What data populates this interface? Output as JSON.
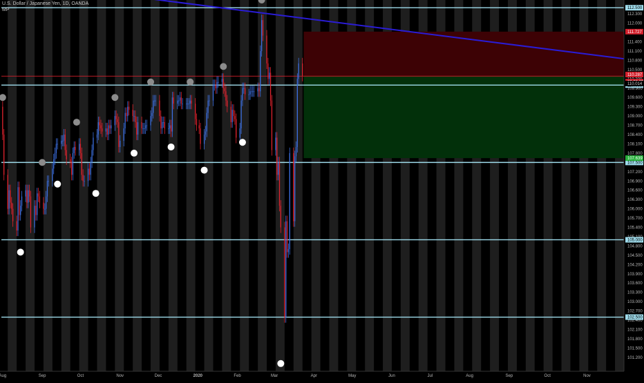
{
  "header": {
    "symbol_line": "U.S. Dollar / Japanese Yen, 1D, OANDA",
    "indicator": "MP"
  },
  "colors": {
    "background": "#000000",
    "band": "#1e1e1e",
    "up": "#3c6fe0",
    "down": "#e0232e",
    "level_line": "#9fdcec",
    "trend_line": "#2a1cd6",
    "loss_zone": "#3d0205",
    "profit_zone": "#02300a",
    "label_bg": "#9fdcec",
    "price_tag": "#d21f2b",
    "tp_tag": "#26b03a",
    "marker_grey": "#8c8c8c",
    "marker_white": "#ffffff"
  },
  "chart_data": {
    "type": "candlestick",
    "title": "U.S. Dollar / Japanese Yen, 1D, OANDA",
    "ylim": [
      100.75,
      112.75
    ],
    "y_ticks": [
      101.2,
      101.5,
      101.8,
      102.1,
      102.4,
      102.7,
      103.0,
      103.3,
      103.6,
      103.9,
      104.2,
      104.5,
      104.8,
      105.1,
      105.4,
      105.7,
      106.0,
      106.3,
      106.6,
      106.9,
      107.2,
      107.5,
      107.8,
      108.1,
      108.4,
      108.7,
      109.0,
      109.3,
      109.6,
      109.9,
      110.2,
      110.5,
      110.8,
      111.1,
      111.4,
      111.7,
      112.0,
      112.3
    ],
    "y_tick_labels": [
      "101.200",
      "101.500",
      "101.800",
      "102.100",
      "102.400",
      "102.700",
      "103.000",
      "103.300",
      "103.600",
      "103.900",
      "104.200",
      "104.500",
      "104.800",
      "105.100",
      "105.400",
      "105.700",
      "106.000",
      "106.300",
      "106.600",
      "106.900",
      "107.200",
      "107.500",
      "107.800",
      "108.100",
      "108.400",
      "108.700",
      "109.000",
      "109.300",
      "109.600",
      "109.900",
      "110.200",
      "110.500",
      "110.800",
      "111.100",
      "111.400",
      "111.700",
      "112.000",
      "112.300"
    ],
    "x_ticks": [
      {
        "label": "Aug",
        "date": "2019-08-01"
      },
      {
        "label": "Sep",
        "date": "2019-09-01"
      },
      {
        "label": "Oct",
        "date": "2019-10-01"
      },
      {
        "label": "Nov",
        "date": "2019-11-01"
      },
      {
        "label": "Dec",
        "date": "2019-12-01"
      },
      {
        "label": "2020",
        "date": "2020-01-01"
      },
      {
        "label": "Feb",
        "date": "2020-02-01"
      },
      {
        "label": "Mar",
        "date": "2020-03-01"
      },
      {
        "label": "Apr",
        "date": "2020-04-01"
      },
      {
        "label": "May",
        "date": "2020-05-01"
      },
      {
        "label": "Jun",
        "date": "2020-06-01"
      },
      {
        "label": "Jul",
        "date": "2020-07-01"
      },
      {
        "label": "Aug",
        "date": "2020-08-01"
      },
      {
        "label": "Sep",
        "date": "2020-09-01"
      },
      {
        "label": "Oct",
        "date": "2020-10-01"
      },
      {
        "label": "Nov",
        "date": "2020-11-01"
      }
    ],
    "x_range": [
      "2019-07-31",
      "2020-11-30"
    ],
    "weekly_shading": "alternating weeks",
    "series": [
      {
        "values": [
          [
            "2019-08-01",
            109.3,
            108.4
          ],
          [
            "2019-08-02",
            108.4,
            107.1
          ],
          [
            "2019-08-05",
            107.1,
            106.0
          ],
          [
            "2019-08-06",
            106.0,
            106.6
          ],
          [
            "2019-08-07",
            106.6,
            106.2
          ],
          [
            "2019-08-08",
            106.2,
            106.0
          ],
          [
            "2019-08-09",
            106.0,
            105.6
          ],
          [
            "2019-08-12",
            105.6,
            105.3
          ],
          [
            "2019-08-13",
            105.3,
            106.7
          ],
          [
            "2019-08-14",
            106.7,
            105.8
          ],
          [
            "2019-08-15",
            105.8,
            106.1
          ],
          [
            "2019-08-16",
            106.1,
            106.4
          ],
          [
            "2019-08-19",
            106.4,
            106.6
          ],
          [
            "2019-08-20",
            106.6,
            106.2
          ],
          [
            "2019-08-21",
            106.2,
            106.6
          ],
          [
            "2019-08-22",
            106.6,
            106.4
          ],
          [
            "2019-08-23",
            106.4,
            105.4
          ],
          [
            "2019-08-26",
            105.4,
            106.1
          ],
          [
            "2019-08-27",
            106.1,
            105.8
          ],
          [
            "2019-08-28",
            105.8,
            106.5
          ],
          [
            "2019-08-29",
            106.5,
            106.4
          ],
          [
            "2019-08-30",
            106.4,
            106.2
          ],
          [
            "2019-09-02",
            106.2,
            106.0
          ],
          [
            "2019-09-03",
            106.0,
            106.0
          ],
          [
            "2019-09-04",
            106.0,
            106.4
          ],
          [
            "2019-09-05",
            106.4,
            106.9
          ],
          [
            "2019-09-06",
            106.9,
            106.9
          ],
          [
            "2019-09-09",
            106.9,
            107.3
          ],
          [
            "2019-09-10",
            107.3,
            107.6
          ],
          [
            "2019-09-11",
            107.6,
            107.8
          ],
          [
            "2019-09-12",
            107.8,
            108.1
          ],
          [
            "2019-09-13",
            108.1,
            108.1
          ],
          [
            "2019-09-16",
            108.1,
            108.2
          ],
          [
            "2019-09-17",
            108.2,
            108.2
          ],
          [
            "2019-09-18",
            108.2,
            108.4
          ],
          [
            "2019-09-19",
            108.4,
            107.9
          ],
          [
            "2019-09-20",
            107.9,
            107.6
          ],
          [
            "2019-09-23",
            107.6,
            107.5
          ],
          [
            "2019-09-24",
            107.5,
            107.1
          ],
          [
            "2019-09-25",
            107.1,
            107.8
          ],
          [
            "2019-09-26",
            107.8,
            108.0
          ],
          [
            "2019-09-27",
            108.0,
            107.9
          ],
          [
            "2019-09-30",
            107.9,
            108.1
          ],
          [
            "2019-10-01",
            108.1,
            107.8
          ],
          [
            "2019-10-02",
            107.8,
            107.1
          ],
          [
            "2019-10-03",
            107.1,
            106.9
          ],
          [
            "2019-10-04",
            106.9,
            106.9
          ],
          [
            "2019-10-07",
            106.9,
            107.3
          ],
          [
            "2019-10-08",
            107.3,
            107.1
          ],
          [
            "2019-10-09",
            107.1,
            107.5
          ],
          [
            "2019-10-10",
            107.5,
            107.9
          ],
          [
            "2019-10-11",
            107.9,
            108.3
          ],
          [
            "2019-10-14",
            108.3,
            108.4
          ],
          [
            "2019-10-15",
            108.4,
            108.8
          ],
          [
            "2019-10-16",
            108.8,
            108.7
          ],
          [
            "2019-10-17",
            108.7,
            108.6
          ],
          [
            "2019-10-18",
            108.6,
            108.5
          ],
          [
            "2019-10-21",
            108.5,
            108.6
          ],
          [
            "2019-10-22",
            108.6,
            108.4
          ],
          [
            "2019-10-23",
            108.4,
            108.7
          ],
          [
            "2019-10-24",
            108.7,
            108.6
          ],
          [
            "2019-10-25",
            108.6,
            108.7
          ],
          [
            "2019-10-28",
            108.7,
            109.0
          ],
          [
            "2019-10-29",
            109.0,
            108.9
          ],
          [
            "2019-10-30",
            108.9,
            108.8
          ],
          [
            "2019-10-31",
            108.8,
            108.0
          ],
          [
            "2019-11-01",
            108.0,
            108.2
          ],
          [
            "2019-11-04",
            108.2,
            108.6
          ],
          [
            "2019-11-05",
            108.6,
            109.1
          ],
          [
            "2019-11-06",
            109.1,
            109.0
          ],
          [
            "2019-11-07",
            109.0,
            109.3
          ],
          [
            "2019-11-08",
            109.3,
            109.2
          ],
          [
            "2019-11-11",
            109.2,
            109.0
          ],
          [
            "2019-11-12",
            109.0,
            109.0
          ],
          [
            "2019-11-13",
            109.0,
            108.8
          ],
          [
            "2019-11-14",
            108.8,
            108.4
          ],
          [
            "2019-11-15",
            108.4,
            108.8
          ],
          [
            "2019-11-18",
            108.8,
            108.6
          ],
          [
            "2019-11-19",
            108.6,
            108.6
          ],
          [
            "2019-11-20",
            108.6,
            108.6
          ],
          [
            "2019-11-21",
            108.6,
            108.7
          ],
          [
            "2019-11-22",
            108.7,
            108.7
          ],
          [
            "2019-11-25",
            108.7,
            109.0
          ],
          [
            "2019-11-26",
            109.0,
            109.1
          ],
          [
            "2019-11-27",
            109.1,
            109.5
          ],
          [
            "2019-11-28",
            109.5,
            109.5
          ],
          [
            "2019-11-29",
            109.5,
            109.5
          ],
          [
            "2019-12-02",
            109.5,
            109.0
          ],
          [
            "2019-12-03",
            109.0,
            108.6
          ],
          [
            "2019-12-04",
            108.6,
            108.8
          ],
          [
            "2019-12-05",
            108.8,
            108.8
          ],
          [
            "2019-12-06",
            108.8,
            108.6
          ],
          [
            "2019-12-09",
            108.6,
            108.6
          ],
          [
            "2019-12-10",
            108.6,
            108.7
          ],
          [
            "2019-12-11",
            108.7,
            108.5
          ],
          [
            "2019-12-12",
            108.5,
            109.6
          ],
          [
            "2019-12-13",
            109.6,
            109.4
          ],
          [
            "2019-12-16",
            109.4,
            109.5
          ],
          [
            "2019-12-17",
            109.5,
            109.5
          ],
          [
            "2019-12-18",
            109.5,
            109.6
          ],
          [
            "2019-12-19",
            109.6,
            109.4
          ],
          [
            "2019-12-20",
            109.4,
            109.4
          ],
          [
            "2019-12-23",
            109.4,
            109.4
          ],
          [
            "2019-12-24",
            109.4,
            109.4
          ],
          [
            "2019-12-25",
            109.4,
            109.4
          ],
          [
            "2019-12-26",
            109.4,
            109.5
          ],
          [
            "2019-12-27",
            109.5,
            109.4
          ],
          [
            "2019-12-30",
            109.4,
            108.9
          ],
          [
            "2019-12-31",
            108.9,
            108.7
          ],
          [
            "2020-01-02",
            108.7,
            108.6
          ],
          [
            "2020-01-03",
            108.6,
            108.1
          ],
          [
            "2020-01-06",
            108.1,
            108.4
          ],
          [
            "2020-01-07",
            108.4,
            108.5
          ],
          [
            "2020-01-08",
            108.5,
            109.1
          ],
          [
            "2020-01-09",
            109.1,
            109.5
          ],
          [
            "2020-01-10",
            109.5,
            109.5
          ],
          [
            "2020-01-13",
            109.5,
            110.0
          ],
          [
            "2020-01-14",
            110.0,
            110.0
          ],
          [
            "2020-01-15",
            110.0,
            109.9
          ],
          [
            "2020-01-16",
            109.9,
            110.1
          ],
          [
            "2020-01-17",
            110.1,
            110.1
          ],
          [
            "2020-01-20",
            110.1,
            110.2
          ],
          [
            "2020-01-21",
            110.2,
            109.9
          ],
          [
            "2020-01-22",
            109.9,
            109.8
          ],
          [
            "2020-01-23",
            109.8,
            109.5
          ],
          [
            "2020-01-24",
            109.5,
            109.3
          ],
          [
            "2020-01-27",
            109.3,
            108.8
          ],
          [
            "2020-01-28",
            108.8,
            109.2
          ],
          [
            "2020-01-29",
            109.2,
            109.0
          ],
          [
            "2020-01-30",
            109.0,
            108.9
          ],
          [
            "2020-01-31",
            108.9,
            108.3
          ],
          [
            "2020-02-03",
            108.3,
            108.6
          ],
          [
            "2020-02-04",
            108.6,
            109.5
          ],
          [
            "2020-02-05",
            109.5,
            109.9
          ],
          [
            "2020-02-06",
            109.9,
            109.9
          ],
          [
            "2020-02-07",
            109.9,
            109.7
          ],
          [
            "2020-02-10",
            109.7,
            109.7
          ],
          [
            "2020-02-11",
            109.7,
            109.8
          ],
          [
            "2020-02-12",
            109.8,
            109.8
          ],
          [
            "2020-02-13",
            109.8,
            109.8
          ],
          [
            "2020-02-14",
            109.8,
            109.8
          ],
          [
            "2020-02-17",
            109.8,
            109.9
          ],
          [
            "2020-02-18",
            109.9,
            109.8
          ],
          [
            "2020-02-19",
            109.8,
            111.1
          ],
          [
            "2020-02-20",
            111.1,
            112.1
          ],
          [
            "2020-02-21",
            112.1,
            111.6
          ],
          [
            "2020-02-24",
            111.6,
            110.7
          ],
          [
            "2020-02-25",
            110.7,
            110.2
          ],
          [
            "2020-02-26",
            110.2,
            110.4
          ],
          [
            "2020-02-27",
            110.4,
            109.5
          ],
          [
            "2020-02-28",
            109.5,
            107.9
          ],
          [
            "2020-03-02",
            107.9,
            108.3
          ],
          [
            "2020-03-03",
            108.3,
            107.1
          ],
          [
            "2020-03-04",
            107.1,
            107.5
          ],
          [
            "2020-03-05",
            107.5,
            106.1
          ],
          [
            "2020-03-06",
            106.1,
            105.4
          ],
          [
            "2020-03-09",
            105.4,
            102.5
          ],
          [
            "2020-03-10",
            102.5,
            105.6
          ],
          [
            "2020-03-11",
            105.6,
            104.6
          ],
          [
            "2020-03-12",
            104.6,
            104.7
          ],
          [
            "2020-03-13",
            104.7,
            107.8
          ],
          [
            "2020-03-16",
            107.8,
            105.6
          ],
          [
            "2020-03-17",
            105.6,
            107.7
          ],
          [
            "2020-03-18",
            107.7,
            108.0
          ],
          [
            "2020-03-19",
            108.0,
            110.2
          ],
          [
            "2020-03-20",
            110.2,
            110.7
          ],
          [
            "2020-03-23",
            110.7,
            110.3
          ]
        ],
        "value_format": [
          "date",
          "open",
          "close"
        ]
      }
    ],
    "horizontal_levels": [
      {
        "price": 112.5,
        "label": "112.500"
      },
      {
        "price": 110.0,
        "label": "110.000"
      },
      {
        "price": 107.5,
        "label": "107.500"
      },
      {
        "price": 105.0,
        "label": "105.000"
      },
      {
        "price": 102.5,
        "label": "102.500"
      }
    ],
    "trend_line": {
      "from": [
        "2019-10-15",
        113.0
      ],
      "to": [
        "2020-11-30",
        110.85
      ]
    },
    "position": {
      "entry": 110.29,
      "stop": 111.727,
      "target": 107.639,
      "start": "2020-03-24",
      "end": "2020-11-30",
      "entry_label": "110.287",
      "entry_time_label": "20:32:05",
      "stop_label": "111.727",
      "target_label": "107.639",
      "mid_label": "110.014"
    },
    "markers": {
      "grey": [
        [
          "2019-08-01",
          109.6
        ],
        [
          "2019-09-01",
          107.5
        ],
        [
          "2019-09-28",
          108.8
        ],
        [
          "2019-10-28",
          109.6
        ],
        [
          "2019-11-25",
          110.1
        ],
        [
          "2019-12-26",
          110.1
        ],
        [
          "2020-01-21",
          110.6
        ],
        [
          "2020-02-20",
          112.75
        ]
      ],
      "white": [
        [
          "2019-08-15",
          104.6
        ],
        [
          "2019-09-13",
          106.8
        ],
        [
          "2019-10-13",
          106.5
        ],
        [
          "2019-11-12",
          107.8
        ],
        [
          "2019-12-11",
          108.0
        ],
        [
          "2020-01-06",
          107.25
        ],
        [
          "2020-02-05",
          108.15
        ],
        [
          "2020-03-06",
          101.0
        ]
      ]
    }
  }
}
